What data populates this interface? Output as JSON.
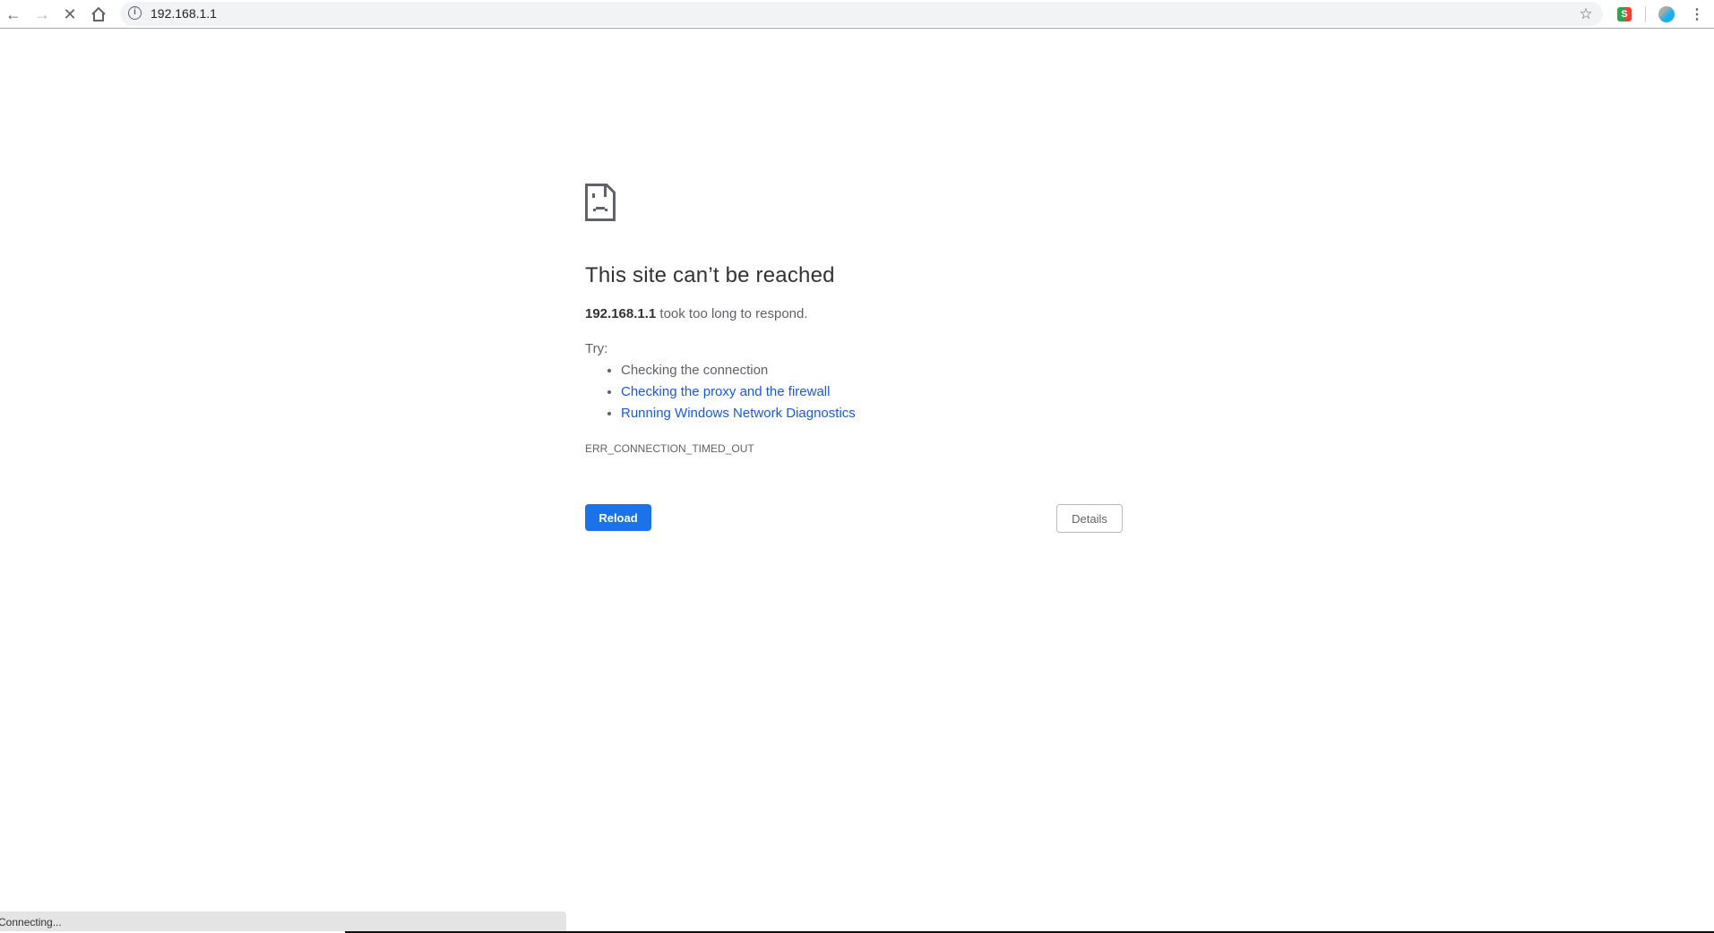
{
  "browser": {
    "url": "192.168.1.1",
    "icons": [
      "back-icon",
      "forward-icon",
      "stop-icon",
      "home-icon",
      "info-icon",
      "star-icon",
      "extension-icon",
      "profile-avatar",
      "menu-icon"
    ],
    "accent": "#1a73e8"
  },
  "error": {
    "title": "This site can’t be reached",
    "host": "192.168.1.1",
    "message": " took too long to respond.",
    "try_label": "Try:",
    "suggestions": [
      {
        "text": "Checking the connection",
        "link": false
      },
      {
        "text": "Checking the proxy and the firewall",
        "link": true
      },
      {
        "text": "Running Windows Network Diagnostics",
        "link": true
      }
    ],
    "code": "ERR_CONNECTION_TIMED_OUT",
    "reload_label": "Reload",
    "details_label": "Details"
  },
  "status": {
    "text": "Connecting..."
  }
}
